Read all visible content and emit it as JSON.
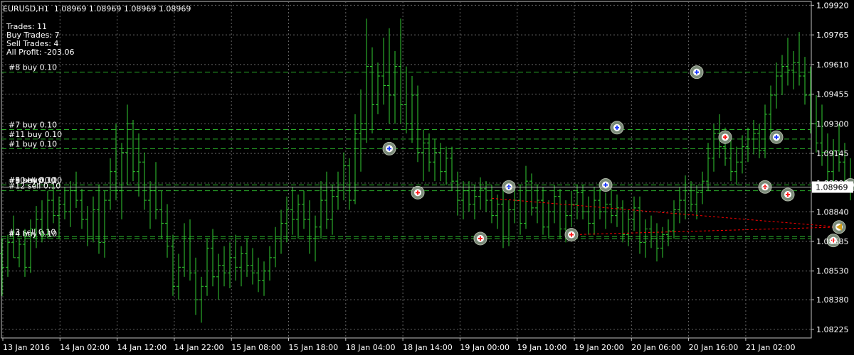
{
  "header": {
    "symbol": "EURUSD,H1",
    "ohlc": "1.08969 1.08969 1.08969 1.08969"
  },
  "stats": [
    "Trades: 11",
    "Buy Trades: 7",
    "Sell Trades: 4",
    "All Profit: -203.06"
  ],
  "colors": {
    "background": "#000000",
    "grid": "#c0c0c0",
    "candle": "#32cd32",
    "buy_level": "#32cd32",
    "sell_level": "#32cd32",
    "profit_line": "#ff0000",
    "price_label_bg": "#ffffff",
    "text": "#ffffff"
  },
  "chart_data": {
    "type": "ohlc",
    "ylim": [
      1.0818,
      1.0994
    ],
    "y_ticks": [
      "1.09920",
      "1.09765",
      "1.09610",
      "1.09455",
      "1.09300",
      "1.09145",
      "1.08990",
      "1.08840",
      "1.08685",
      "1.08530",
      "1.08380",
      "1.08225"
    ],
    "current_price": "1.08969",
    "x_tick_labels": [
      "13 Jan 2016",
      "14 Jan 02:00",
      "14 Jan 12:00",
      "14 Jan 22:00",
      "15 Jan 08:00",
      "15 Jan 18:00",
      "18 Jan 04:00",
      "18 Jan 14:00",
      "19 Jan 00:00",
      "19 Jan 10:00",
      "19 Jan 20:00",
      "20 Jan 06:00",
      "20 Jan 16:00",
      "21 Jan 02:00"
    ],
    "order_levels": [
      {
        "label": "#8 buy 0.10",
        "price": 1.0957
      },
      {
        "label": "#7 buy 0.10",
        "price": 1.0927
      },
      {
        "label": "#11 buy 0.10",
        "price": 1.0922
      },
      {
        "label": "#1 buy 0.10",
        "price": 1.0917
      },
      {
        "label": "#5 buy 0.10",
        "price": 1.0898
      },
      {
        "label": "#6 buy 0.10",
        "price": 1.0898
      },
      {
        "label": "#9 sell 0.10",
        "price": 1.0898
      },
      {
        "label": "#10 buy 0.10",
        "price": 1.0898
      },
      {
        "label": "#12 sell 0.10",
        "price": 1.0895
      },
      {
        "label": "#3 sell 0.10",
        "price": 1.0871
      },
      {
        "label": "#4 buy 0.10",
        "price": 1.087
      }
    ],
    "trade_markers": [
      {
        "kind": "buy",
        "date": "15 Jan 20:00",
        "price": 1.0917
      },
      {
        "kind": "sell",
        "date": "18 Jan 01:00",
        "price": 1.0894
      },
      {
        "kind": "sell",
        "date": "18 Jan 12:00",
        "price": 1.087
      },
      {
        "kind": "buy",
        "date": "18 Jan 17:00",
        "price": 1.0897
      },
      {
        "kind": "sell",
        "date": "19 Jan 04:00",
        "price": 1.0872
      },
      {
        "kind": "buy",
        "date": "19 Jan 10:00",
        "price": 1.0898
      },
      {
        "kind": "buy",
        "date": "19 Jan 12:00",
        "price": 1.0928
      },
      {
        "kind": "buy",
        "date": "20 Jan 02:00",
        "price": 1.0957
      },
      {
        "kind": "sell",
        "date": "20 Jan 07:00",
        "price": 1.0923
      },
      {
        "kind": "sell",
        "date": "20 Jan 14:00",
        "price": 1.0897
      },
      {
        "kind": "buy",
        "date": "20 Jan 16:00",
        "price": 1.0923
      },
      {
        "kind": "sell",
        "date": "20 Jan 18:00",
        "price": 1.0893
      },
      {
        "kind": "sell",
        "date": "21 Jan 02:00",
        "price": 1.0869
      },
      {
        "kind": "close",
        "date": "21 Jan 03:00",
        "price": 1.0876
      },
      {
        "kind": "buy",
        "date": "21 Jan 05:00",
        "price": 1.0898
      }
    ],
    "profit_lines": [
      {
        "from": {
          "date": "18 Jan 14:00",
          "price": 1.0891
        },
        "to": {
          "date": "21 Jan 03:00",
          "price": 1.0876
        }
      },
      {
        "from": {
          "date": "19 Jan 04:00",
          "price": 1.0872
        },
        "to": {
          "date": "21 Jan 03:00",
          "price": 1.0876
        }
      }
    ],
    "bars": [
      [
        1.0862,
        1.087,
        1.084,
        1.0855
      ],
      [
        1.0855,
        1.0872,
        1.085,
        1.0868
      ],
      [
        1.0868,
        1.0882,
        1.086,
        1.086
      ],
      [
        1.086,
        1.087,
        1.0855,
        1.0867
      ],
      [
        1.0867,
        1.0875,
        1.085,
        1.0855
      ],
      [
        1.0855,
        1.088,
        1.0852,
        1.0875
      ],
      [
        1.0875,
        1.0887,
        1.0865,
        1.088
      ],
      [
        1.088,
        1.089,
        1.0868,
        1.0872
      ],
      [
        1.0872,
        1.0895,
        1.087,
        1.089
      ],
      [
        1.089,
        1.0898,
        1.0878,
        1.0882
      ],
      [
        1.0882,
        1.0892,
        1.087,
        1.0888
      ],
      [
        1.0888,
        1.0897,
        1.088,
        1.0884
      ],
      [
        1.0884,
        1.09,
        1.0876,
        1.0895
      ],
      [
        1.0895,
        1.0905,
        1.0886,
        1.089
      ],
      [
        1.089,
        1.0896,
        1.0875,
        1.088
      ],
      [
        1.088,
        1.0887,
        1.0866,
        1.087
      ],
      [
        1.087,
        1.0892,
        1.0868,
        1.0885
      ],
      [
        1.0885,
        1.0898,
        1.0862,
        1.0868
      ],
      [
        1.0868,
        1.0895,
        1.086,
        1.089
      ],
      [
        1.089,
        1.0912,
        1.0885,
        1.0905
      ],
      [
        1.0905,
        1.093,
        1.089,
        1.0895
      ],
      [
        1.0895,
        1.092,
        1.088,
        1.0915
      ],
      [
        1.0915,
        1.094,
        1.0898,
        1.093
      ],
      [
        1.093,
        1.0932,
        1.09,
        1.0905
      ],
      [
        1.0905,
        1.0925,
        1.0892,
        1.091
      ],
      [
        1.091,
        1.0915,
        1.0885,
        1.089
      ],
      [
        1.089,
        1.09,
        1.0875,
        1.0895
      ],
      [
        1.0895,
        1.091,
        1.088,
        1.0885
      ],
      [
        1.0885,
        1.0895,
        1.087,
        1.0878
      ],
      [
        1.0878,
        1.0888,
        1.086,
        1.0866
      ],
      [
        1.0866,
        1.0872,
        1.084,
        1.0845
      ],
      [
        1.0845,
        1.0862,
        1.0838,
        1.0855
      ],
      [
        1.0855,
        1.0878,
        1.085,
        1.087
      ],
      [
        1.087,
        1.088,
        1.0848,
        1.0852
      ],
      [
        1.0852,
        1.086,
        1.083,
        1.0838
      ],
      [
        1.0838,
        1.085,
        1.0826,
        1.0845
      ],
      [
        1.0845,
        1.087,
        1.084,
        1.0865
      ],
      [
        1.0865,
        1.0875,
        1.0845,
        1.085
      ],
      [
        1.085,
        1.0862,
        1.0838,
        1.0856
      ],
      [
        1.0856,
        1.0866,
        1.0845,
        1.0852
      ],
      [
        1.0852,
        1.0868,
        1.0844,
        1.086
      ],
      [
        1.086,
        1.0872,
        1.0848,
        1.0855
      ],
      [
        1.0855,
        1.0866,
        1.0845,
        1.0862
      ],
      [
        1.0862,
        1.087,
        1.085,
        1.0856
      ],
      [
        1.0856,
        1.0865,
        1.0846,
        1.0852
      ],
      [
        1.0852,
        1.086,
        1.0842,
        1.0848
      ],
      [
        1.0848,
        1.0858,
        1.084,
        1.0853
      ],
      [
        1.0853,
        1.0866,
        1.0848,
        1.086
      ],
      [
        1.086,
        1.0876,
        1.0855,
        1.087
      ],
      [
        1.087,
        1.0885,
        1.0862,
        1.0878
      ],
      [
        1.0878,
        1.0892,
        1.0868,
        1.0885
      ],
      [
        1.0885,
        1.0897,
        1.0872,
        1.088
      ],
      [
        1.088,
        1.0893,
        1.087,
        1.0888
      ],
      [
        1.0888,
        1.0895,
        1.0875,
        1.088
      ],
      [
        1.088,
        1.089,
        1.0862,
        1.087
      ],
      [
        1.087,
        1.0882,
        1.0858,
        1.0876
      ],
      [
        1.0876,
        1.09,
        1.087,
        1.089
      ],
      [
        1.089,
        1.0905,
        1.0875,
        1.088
      ],
      [
        1.088,
        1.0898,
        1.0872,
        1.0892
      ],
      [
        1.0892,
        1.0905,
        1.0885,
        1.0898
      ],
      [
        1.0898,
        1.0915,
        1.089,
        1.0908
      ],
      [
        1.0908,
        1.0912,
        1.0885,
        1.089
      ],
      [
        1.089,
        1.0935,
        1.0888,
        1.0925
      ],
      [
        1.0925,
        1.0948,
        1.0905,
        1.093
      ],
      [
        1.093,
        1.0985,
        1.092,
        1.096
      ],
      [
        1.096,
        1.097,
        1.0925,
        1.094
      ],
      [
        1.094,
        1.0962,
        1.0935,
        1.0955
      ],
      [
        1.0955,
        1.0975,
        1.094,
        1.095
      ],
      [
        1.095,
        1.098,
        1.093,
        1.0945
      ],
      [
        1.0945,
        1.0968,
        1.093,
        1.096
      ],
      [
        1.096,
        1.0985,
        1.093,
        1.094
      ],
      [
        1.094,
        1.096,
        1.0925,
        1.093
      ],
      [
        1.093,
        1.0955,
        1.092,
        1.0945
      ],
      [
        1.0945,
        1.095,
        1.091,
        1.0915
      ],
      [
        1.0915,
        1.0927,
        1.09,
        1.092
      ],
      [
        1.092,
        1.0925,
        1.0905,
        1.091
      ],
      [
        1.091,
        1.0922,
        1.09,
        1.0915
      ],
      [
        1.0915,
        1.092,
        1.09,
        1.0905
      ],
      [
        1.0905,
        1.0918,
        1.0898,
        1.0912
      ],
      [
        1.0912,
        1.0918,
        1.0895,
        1.09
      ],
      [
        1.09,
        1.0905,
        1.0882,
        1.089
      ],
      [
        1.089,
        1.09,
        1.088,
        1.0895
      ],
      [
        1.0895,
        1.09,
        1.0884,
        1.0888
      ],
      [
        1.0888,
        1.0898,
        1.088,
        1.0892
      ],
      [
        1.0892,
        1.0902,
        1.0885,
        1.0896
      ],
      [
        1.0896,
        1.09,
        1.0884,
        1.089
      ],
      [
        1.089,
        1.0898,
        1.0878,
        1.0882
      ],
      [
        1.0882,
        1.0893,
        1.0875,
        1.0888
      ],
      [
        1.0888,
        1.0895,
        1.0865,
        1.087
      ],
      [
        1.087,
        1.089,
        1.0866,
        1.0885
      ],
      [
        1.0885,
        1.0895,
        1.0878,
        1.089
      ],
      [
        1.089,
        1.0898,
        1.0872,
        1.0878
      ],
      [
        1.0878,
        1.0908,
        1.0875,
        1.09
      ],
      [
        1.09,
        1.0904,
        1.0882,
        1.0886
      ],
      [
        1.0886,
        1.0898,
        1.0878,
        1.089
      ],
      [
        1.089,
        1.0897,
        1.0872,
        1.0876
      ],
      [
        1.0876,
        1.089,
        1.087,
        1.0884
      ],
      [
        1.0884,
        1.0898,
        1.0878,
        1.0892
      ],
      [
        1.0892,
        1.0896,
        1.087,
        1.0875
      ],
      [
        1.0875,
        1.089,
        1.0868,
        1.0882
      ],
      [
        1.0882,
        1.0895,
        1.0876,
        1.0888
      ],
      [
        1.0888,
        1.0898,
        1.088,
        1.0894
      ],
      [
        1.0894,
        1.0898,
        1.088,
        1.0884
      ],
      [
        1.0884,
        1.0892,
        1.0872,
        1.0878
      ],
      [
        1.0878,
        1.0897,
        1.0872,
        1.089
      ],
      [
        1.089,
        1.0896,
        1.088,
        1.0884
      ],
      [
        1.0884,
        1.0894,
        1.0875,
        1.0888
      ],
      [
        1.0888,
        1.0896,
        1.0878,
        1.0882
      ],
      [
        1.0882,
        1.0893,
        1.0876,
        1.0886
      ],
      [
        1.0886,
        1.089,
        1.0868,
        1.0872
      ],
      [
        1.0872,
        1.0885,
        1.0866,
        1.088
      ],
      [
        1.088,
        1.0892,
        1.0874,
        1.0886
      ],
      [
        1.0886,
        1.0892,
        1.0862,
        1.0868
      ],
      [
        1.0868,
        1.088,
        1.086,
        1.0875
      ],
      [
        1.0875,
        1.0882,
        1.0865,
        1.087
      ],
      [
        1.087,
        1.0878,
        1.0858,
        1.0865
      ],
      [
        1.0865,
        1.0876,
        1.086,
        1.0872
      ],
      [
        1.0872,
        1.088,
        1.0866,
        1.0874
      ],
      [
        1.0874,
        1.089,
        1.087,
        1.0885
      ],
      [
        1.0885,
        1.0897,
        1.0878,
        1.089
      ],
      [
        1.089,
        1.0903,
        1.088,
        1.0895
      ],
      [
        1.0895,
        1.09,
        1.0884,
        1.0888
      ],
      [
        1.0888,
        1.0898,
        1.088,
        1.0894
      ],
      [
        1.0894,
        1.0905,
        1.0888,
        1.09
      ],
      [
        1.09,
        1.092,
        1.0895,
        1.0912
      ],
      [
        1.0912,
        1.093,
        1.0905,
        1.0925
      ],
      [
        1.0925,
        1.0935,
        1.0912,
        1.0918
      ],
      [
        1.0918,
        1.0928,
        1.0908,
        1.0912
      ],
      [
        1.0912,
        1.0922,
        1.09,
        1.0905
      ],
      [
        1.0905,
        1.0918,
        1.0898,
        1.091
      ],
      [
        1.091,
        1.0924,
        1.0904,
        1.0918
      ],
      [
        1.0918,
        1.0928,
        1.091,
        1.0922
      ],
      [
        1.0922,
        1.0932,
        1.0914,
        1.0925
      ],
      [
        1.0925,
        1.093,
        1.0912,
        1.0916
      ],
      [
        1.0916,
        1.094,
        1.0912,
        1.0935
      ],
      [
        1.0935,
        1.095,
        1.0925,
        1.0945
      ],
      [
        1.0945,
        1.0962,
        1.0938,
        1.0955
      ],
      [
        1.0955,
        1.0966,
        1.0945,
        1.096
      ],
      [
        1.096,
        1.0975,
        1.095,
        1.0958
      ],
      [
        1.0958,
        1.0968,
        1.0948,
        1.0962
      ],
      [
        1.0962,
        1.0978,
        1.095,
        1.0955
      ],
      [
        1.0955,
        1.0965,
        1.094,
        1.0945
      ],
      [
        1.0945,
        1.096,
        1.0925,
        1.093
      ],
      [
        1.093,
        1.0945,
        1.0915,
        1.092
      ],
      [
        1.092,
        1.094,
        1.0908,
        1.0915
      ],
      [
        1.0915,
        1.0925,
        1.09,
        1.0905
      ],
      [
        1.0905,
        1.0922,
        1.0898,
        1.0916
      ],
      [
        1.0916,
        1.093,
        1.0905,
        1.091
      ],
      [
        1.091,
        1.092,
        1.0895,
        1.09
      ],
      [
        1.09,
        1.0912,
        1.089,
        1.0895
      ],
      [
        1.0895,
        1.0905,
        1.0884,
        1.089
      ],
      [
        1.089,
        1.093,
        1.0886,
        1.092
      ],
      [
        1.092,
        1.0925,
        1.089,
        1.0895
      ],
      [
        1.0895,
        1.0905,
        1.0886,
        1.0898
      ],
      [
        1.0898,
        1.0906,
        1.0882,
        1.0888
      ],
      [
        1.0888,
        1.0896,
        1.0876,
        1.0884
      ],
      [
        1.0884,
        1.0895,
        1.0878,
        1.089
      ],
      [
        1.089,
        1.0895,
        1.087,
        1.0875
      ],
      [
        1.0875,
        1.0885,
        1.0866,
        1.088
      ],
      [
        1.088,
        1.0886,
        1.0864,
        1.087
      ],
      [
        1.087,
        1.088,
        1.0862,
        1.0875
      ],
      [
        1.0875,
        1.089,
        1.087,
        1.0885
      ],
      [
        1.0885,
        1.0898,
        1.0878,
        1.0895
      ],
      [
        1.0895,
        1.0905,
        1.089,
        1.0898
      ],
      [
        1.0898,
        1.09,
        1.0892,
        1.0897
      ]
    ]
  }
}
